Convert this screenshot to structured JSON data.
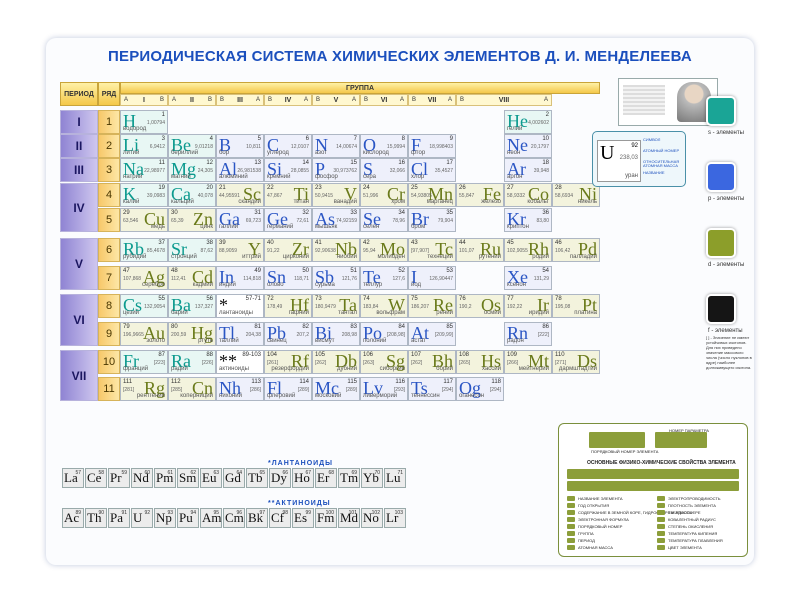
{
  "title": "ПЕРИОДИЧЕСКАЯ СИСТЕМА ХИМИЧЕСКИХ ЭЛЕМЕНТОВ Д. И. МЕНДЕЛЕЕВА",
  "headers": {
    "period": "ПЕРИОД",
    "row": "РЯД",
    "group": "ГРУППА"
  },
  "groups": [
    {
      "roman": "I",
      "a": "A",
      "b": "B"
    },
    {
      "roman": "II",
      "a": "A",
      "b": "B"
    },
    {
      "roman": "III",
      "a": "B",
      "b": "A"
    },
    {
      "roman": "IV",
      "a": "B",
      "b": "A"
    },
    {
      "roman": "V",
      "a": "B",
      "b": "A"
    },
    {
      "roman": "VI",
      "a": "B",
      "b": "A"
    },
    {
      "roman": "VII",
      "a": "B",
      "b": "A"
    },
    {
      "roman": "VIII",
      "a": "B",
      "b": "A"
    }
  ],
  "periods": [
    {
      "label": "I",
      "rows": 1
    },
    {
      "label": "II",
      "rows": 1
    },
    {
      "label": "III",
      "rows": 1
    },
    {
      "label": "IV",
      "rows": 2
    },
    {
      "label": "V",
      "rows": 2
    },
    {
      "label": "VI",
      "rows": 2
    },
    {
      "label": "VII",
      "rows": 2
    }
  ],
  "rows": [
    "1",
    "2",
    "3",
    "4",
    "5",
    "6",
    "7",
    "8",
    "9",
    "10",
    "11"
  ],
  "elements": [
    {
      "r": 0,
      "c": 0,
      "sym": "H",
      "z": "1",
      "mass": "1,00794",
      "name": "водород",
      "t": "s",
      "al": "l"
    },
    {
      "r": 0,
      "c": 8,
      "sym": "He",
      "z": "2",
      "mass": "4,002602",
      "name": "гелий",
      "t": "s",
      "al": "l"
    },
    {
      "r": 1,
      "c": 0,
      "sym": "Li",
      "z": "3",
      "mass": "6,9412",
      "name": "литий",
      "t": "s",
      "al": "l"
    },
    {
      "r": 1,
      "c": 1,
      "sym": "Be",
      "z": "4",
      "mass": "9,01218",
      "name": "бериллий",
      "t": "s",
      "al": "l"
    },
    {
      "r": 1,
      "c": 2,
      "sym": "B",
      "z": "5",
      "mass": "10,811",
      "name": "бор",
      "t": "p",
      "al": "l"
    },
    {
      "r": 1,
      "c": 3,
      "sym": "C",
      "z": "6",
      "mass": "12,0107",
      "name": "углерод",
      "t": "p",
      "al": "l"
    },
    {
      "r": 1,
      "c": 4,
      "sym": "N",
      "z": "7",
      "mass": "14,00674",
      "name": "азот",
      "t": "p",
      "al": "l"
    },
    {
      "r": 1,
      "c": 5,
      "sym": "O",
      "z": "8",
      "mass": "15,9994",
      "name": "кислород",
      "t": "p",
      "al": "l"
    },
    {
      "r": 1,
      "c": 6,
      "sym": "F",
      "z": "9",
      "mass": "18,998403",
      "name": "фтор",
      "t": "p",
      "al": "l"
    },
    {
      "r": 1,
      "c": 8,
      "sym": "Ne",
      "z": "10",
      "mass": "20,1797",
      "name": "неон",
      "t": "p",
      "al": "l"
    },
    {
      "r": 2,
      "c": 0,
      "sym": "Na",
      "z": "11",
      "mass": "22,98977",
      "name": "натрий",
      "t": "s",
      "al": "l"
    },
    {
      "r": 2,
      "c": 1,
      "sym": "Mg",
      "z": "12",
      "mass": "24,305",
      "name": "магний",
      "t": "s",
      "al": "l"
    },
    {
      "r": 2,
      "c": 2,
      "sym": "Al",
      "z": "13",
      "mass": "26,981538",
      "name": "алюминий",
      "t": "p",
      "al": "l"
    },
    {
      "r": 2,
      "c": 3,
      "sym": "Si",
      "z": "14",
      "mass": "28,0855",
      "name": "кремний",
      "t": "p",
      "al": "l"
    },
    {
      "r": 2,
      "c": 4,
      "sym": "P",
      "z": "15",
      "mass": "30,973762",
      "name": "фосфор",
      "t": "p",
      "al": "l"
    },
    {
      "r": 2,
      "c": 5,
      "sym": "S",
      "z": "16",
      "mass": "32,066",
      "name": "сера",
      "t": "p",
      "al": "l"
    },
    {
      "r": 2,
      "c": 6,
      "sym": "Cl",
      "z": "17",
      "mass": "35,4527",
      "name": "хлор",
      "t": "p",
      "al": "l"
    },
    {
      "r": 2,
      "c": 8,
      "sym": "Ar",
      "z": "18",
      "mass": "39,948",
      "name": "аргон",
      "t": "p",
      "al": "l"
    },
    {
      "r": 3,
      "c": 0,
      "sym": "K",
      "z": "19",
      "mass": "39,0983",
      "name": "калий",
      "t": "s",
      "al": "l"
    },
    {
      "r": 3,
      "c": 1,
      "sym": "Ca",
      "z": "20",
      "mass": "40,078",
      "name": "кальций",
      "t": "s",
      "al": "l"
    },
    {
      "r": 3,
      "c": 2,
      "sym": "Sc",
      "z": "21",
      "mass": "44,95591",
      "name": "скандий",
      "t": "d",
      "al": "r"
    },
    {
      "r": 3,
      "c": 3,
      "sym": "Ti",
      "z": "22",
      "mass": "47,867",
      "name": "титан",
      "t": "d",
      "al": "r"
    },
    {
      "r": 3,
      "c": 4,
      "sym": "V",
      "z": "23",
      "mass": "50,9415",
      "name": "ванадий",
      "t": "d",
      "al": "r"
    },
    {
      "r": 3,
      "c": 5,
      "sym": "Cr",
      "z": "24",
      "mass": "51,996",
      "name": "хром",
      "t": "d",
      "al": "r"
    },
    {
      "r": 3,
      "c": 6,
      "sym": "Mn",
      "z": "25",
      "mass": "54,93805",
      "name": "марганец",
      "t": "d",
      "al": "r"
    },
    {
      "r": 3,
      "c": 7,
      "sym": "Fe",
      "z": "26",
      "mass": "55,847",
      "name": "железо",
      "t": "d",
      "al": "r"
    },
    {
      "r": 3,
      "c": 8,
      "sym": "Co",
      "z": "27",
      "mass": "58,9332",
      "name": "кобальт",
      "t": "d",
      "al": "r"
    },
    {
      "r": 3,
      "c": 9,
      "sym": "Ni",
      "z": "28",
      "mass": "58,6934",
      "name": "никель",
      "t": "d",
      "al": "r"
    },
    {
      "r": 4,
      "c": 0,
      "sym": "Cu",
      "z": "29",
      "mass": "63,546",
      "name": "медь",
      "t": "d",
      "al": "r"
    },
    {
      "r": 4,
      "c": 1,
      "sym": "Zn",
      "z": "30",
      "mass": "65,39",
      "name": "цинк",
      "t": "d",
      "al": "r"
    },
    {
      "r": 4,
      "c": 2,
      "sym": "Ga",
      "z": "31",
      "mass": "69,723",
      "name": "галлий",
      "t": "p",
      "al": "l"
    },
    {
      "r": 4,
      "c": 3,
      "sym": "Ge",
      "z": "32",
      "mass": "72,61",
      "name": "германий",
      "t": "p",
      "al": "l"
    },
    {
      "r": 4,
      "c": 4,
      "sym": "As",
      "z": "33",
      "mass": "74,92159",
      "name": "мышьяк",
      "t": "p",
      "al": "l"
    },
    {
      "r": 4,
      "c": 5,
      "sym": "Se",
      "z": "34",
      "mass": "78,96",
      "name": "селен",
      "t": "p",
      "al": "l"
    },
    {
      "r": 4,
      "c": 6,
      "sym": "Br",
      "z": "35",
      "mass": "79,904",
      "name": "бром",
      "t": "p",
      "al": "l"
    },
    {
      "r": 4,
      "c": 8,
      "sym": "Kr",
      "z": "36",
      "mass": "83,80",
      "name": "криптон",
      "t": "p",
      "al": "l"
    },
    {
      "r": 5,
      "c": 0,
      "sym": "Rb",
      "z": "37",
      "mass": "85,4678",
      "name": "рубидий",
      "t": "s",
      "al": "l"
    },
    {
      "r": 5,
      "c": 1,
      "sym": "Sr",
      "z": "38",
      "mass": "87,62",
      "name": "стронций",
      "t": "s",
      "al": "l"
    },
    {
      "r": 5,
      "c": 2,
      "sym": "Y",
      "z": "39",
      "mass": "88,9059",
      "name": "иттрий",
      "t": "d",
      "al": "r"
    },
    {
      "r": 5,
      "c": 3,
      "sym": "Zr",
      "z": "40",
      "mass": "91,22",
      "name": "цирконий",
      "t": "d",
      "al": "r"
    },
    {
      "r": 5,
      "c": 4,
      "sym": "Nb",
      "z": "41",
      "mass": "92,90638",
      "name": "ниобий",
      "t": "d",
      "al": "r"
    },
    {
      "r": 5,
      "c": 5,
      "sym": "Mo",
      "z": "42",
      "mass": "95,94",
      "name": "молибден",
      "t": "d",
      "al": "r"
    },
    {
      "r": 5,
      "c": 6,
      "sym": "Tc",
      "z": "43",
      "mass": "[97,907]",
      "name": "технеций",
      "t": "d",
      "al": "r"
    },
    {
      "r": 5,
      "c": 7,
      "sym": "Ru",
      "z": "44",
      "mass": "101,07",
      "name": "рутений",
      "t": "d",
      "al": "r"
    },
    {
      "r": 5,
      "c": 8,
      "sym": "Rh",
      "z": "45",
      "mass": "102,9055",
      "name": "родий",
      "t": "d",
      "al": "r"
    },
    {
      "r": 5,
      "c": 9,
      "sym": "Pd",
      "z": "46",
      "mass": "106,42",
      "name": "палладий",
      "t": "d",
      "al": "r"
    },
    {
      "r": 6,
      "c": 0,
      "sym": "Ag",
      "z": "47",
      "mass": "107,868",
      "name": "серебро",
      "t": "d",
      "al": "r"
    },
    {
      "r": 6,
      "c": 1,
      "sym": "Cd",
      "z": "48",
      "mass": "112,41",
      "name": "кадмий",
      "t": "d",
      "al": "r"
    },
    {
      "r": 6,
      "c": 2,
      "sym": "In",
      "z": "49",
      "mass": "114,818",
      "name": "индий",
      "t": "p",
      "al": "l"
    },
    {
      "r": 6,
      "c": 3,
      "sym": "Sn",
      "z": "50",
      "mass": "118,71",
      "name": "олово",
      "t": "p",
      "al": "l"
    },
    {
      "r": 6,
      "c": 4,
      "sym": "Sb",
      "z": "51",
      "mass": "121,76",
      "name": "сурьма",
      "t": "p",
      "al": "l"
    },
    {
      "r": 6,
      "c": 5,
      "sym": "Te",
      "z": "52",
      "mass": "127,6",
      "name": "теллур",
      "t": "p",
      "al": "l"
    },
    {
      "r": 6,
      "c": 6,
      "sym": "I",
      "z": "53",
      "mass": "126,90447",
      "name": "йод",
      "t": "p",
      "al": "l"
    },
    {
      "r": 6,
      "c": 8,
      "sym": "Xe",
      "z": "54",
      "mass": "131,29",
      "name": "ксенон",
      "t": "p",
      "al": "l"
    },
    {
      "r": 7,
      "c": 0,
      "sym": "Cs",
      "z": "55",
      "mass": "132,9054",
      "name": "цезий",
      "t": "s",
      "al": "l"
    },
    {
      "r": 7,
      "c": 1,
      "sym": "Ba",
      "z": "56",
      "mass": "137,327",
      "name": "барий",
      "t": "s",
      "al": "l"
    },
    {
      "r": 7,
      "c": 2,
      "sym": "*",
      "z": "57-71",
      "mass": "",
      "name": "лантаноиды",
      "t": "n",
      "al": "l"
    },
    {
      "r": 7,
      "c": 3,
      "sym": "Hf",
      "z": "72",
      "mass": "178,49",
      "name": "гафний",
      "t": "d",
      "al": "r"
    },
    {
      "r": 7,
      "c": 4,
      "sym": "Ta",
      "z": "73",
      "mass": "180,9479",
      "name": "тантал",
      "t": "d",
      "al": "r"
    },
    {
      "r": 7,
      "c": 5,
      "sym": "W",
      "z": "74",
      "mass": "183,84",
      "name": "вольфрам",
      "t": "d",
      "al": "r"
    },
    {
      "r": 7,
      "c": 6,
      "sym": "Re",
      "z": "75",
      "mass": "186,207",
      "name": "рений",
      "t": "d",
      "al": "r"
    },
    {
      "r": 7,
      "c": 7,
      "sym": "Os",
      "z": "76",
      "mass": "190,2",
      "name": "осмий",
      "t": "d",
      "al": "r"
    },
    {
      "r": 7,
      "c": 8,
      "sym": "Ir",
      "z": "77",
      "mass": "192,22",
      "name": "иридий",
      "t": "d",
      "al": "r"
    },
    {
      "r": 7,
      "c": 9,
      "sym": "Pt",
      "z": "78",
      "mass": "195,08",
      "name": "платина",
      "t": "d",
      "al": "r"
    },
    {
      "r": 8,
      "c": 0,
      "sym": "Au",
      "z": "79",
      "mass": "196,9665",
      "name": "золото",
      "t": "d",
      "al": "r"
    },
    {
      "r": 8,
      "c": 1,
      "sym": "Hg",
      "z": "80",
      "mass": "200,59",
      "name": "ртуть",
      "t": "d",
      "al": "r"
    },
    {
      "r": 8,
      "c": 2,
      "sym": "Tl",
      "z": "81",
      "mass": "204,38",
      "name": "таллий",
      "t": "p",
      "al": "l"
    },
    {
      "r": 8,
      "c": 3,
      "sym": "Pb",
      "z": "82",
      "mass": "207,2",
      "name": "свинец",
      "t": "p",
      "al": "l"
    },
    {
      "r": 8,
      "c": 4,
      "sym": "Bi",
      "z": "83",
      "mass": "208,98",
      "name": "висмут",
      "t": "p",
      "al": "l"
    },
    {
      "r": 8,
      "c": 5,
      "sym": "Po",
      "z": "84",
      "mass": "[208,98]",
      "name": "полоний",
      "t": "p",
      "al": "l"
    },
    {
      "r": 8,
      "c": 6,
      "sym": "At",
      "z": "85",
      "mass": "[209,99]",
      "name": "астат",
      "t": "p",
      "al": "l"
    },
    {
      "r": 8,
      "c": 8,
      "sym": "Rn",
      "z": "86",
      "mass": "[222]",
      "name": "радон",
      "t": "p",
      "al": "l"
    },
    {
      "r": 9,
      "c": 0,
      "sym": "Fr",
      "z": "87",
      "mass": "[223]",
      "name": "франций",
      "t": "s",
      "al": "l"
    },
    {
      "r": 9,
      "c": 1,
      "sym": "Ra",
      "z": "88",
      "mass": "[226]",
      "name": "радий",
      "t": "s",
      "al": "l"
    },
    {
      "r": 9,
      "c": 2,
      "sym": "**",
      "z": "89-103",
      "mass": "",
      "name": "актиноиды",
      "t": "n",
      "al": "l"
    },
    {
      "r": 9,
      "c": 3,
      "sym": "Rf",
      "z": "104",
      "mass": "[261]",
      "name": "резерфордий",
      "t": "d",
      "al": "r"
    },
    {
      "r": 9,
      "c": 4,
      "sym": "Db",
      "z": "105",
      "mass": "[262]",
      "name": "дубний",
      "t": "d",
      "al": "r"
    },
    {
      "r": 9,
      "c": 5,
      "sym": "Sg",
      "z": "106",
      "mass": "[263]",
      "name": "сиборгий",
      "t": "d",
      "al": "r"
    },
    {
      "r": 9,
      "c": 6,
      "sym": "Bh",
      "z": "107",
      "mass": "[262]",
      "name": "борий",
      "t": "d",
      "al": "r"
    },
    {
      "r": 9,
      "c": 7,
      "sym": "Hs",
      "z": "108",
      "mass": "[265]",
      "name": "хассий",
      "t": "d",
      "al": "r"
    },
    {
      "r": 9,
      "c": 8,
      "sym": "Mt",
      "z": "109",
      "mass": "[266]",
      "name": "мейтнерий",
      "t": "d",
      "al": "r"
    },
    {
      "r": 9,
      "c": 9,
      "sym": "Ds",
      "z": "110",
      "mass": "[271]",
      "name": "дармштадтий",
      "t": "d",
      "al": "r"
    },
    {
      "r": 10,
      "c": 0,
      "sym": "Rg",
      "z": "111",
      "mass": "[281]",
      "name": "рентгений",
      "t": "d",
      "al": "r"
    },
    {
      "r": 10,
      "c": 1,
      "sym": "Cn",
      "z": "112",
      "mass": "[285]",
      "name": "коперниций",
      "t": "d",
      "al": "r"
    },
    {
      "r": 10,
      "c": 2,
      "sym": "Nh",
      "z": "113",
      "mass": "[286]",
      "name": "нихоний",
      "t": "p",
      "al": "l"
    },
    {
      "r": 10,
      "c": 3,
      "sym": "Fl",
      "z": "114",
      "mass": "[289]",
      "name": "флеровий",
      "t": "p",
      "al": "l"
    },
    {
      "r": 10,
      "c": 4,
      "sym": "Mc",
      "z": "115",
      "mass": "[289]",
      "name": "московий",
      "t": "p",
      "al": "l"
    },
    {
      "r": 10,
      "c": 5,
      "sym": "Lv",
      "z": "116",
      "mass": "[293]",
      "name": "ливерморий",
      "t": "p",
      "al": "l"
    },
    {
      "r": 10,
      "c": 6,
      "sym": "Ts",
      "z": "117",
      "mass": "[294]",
      "name": "теннессин",
      "t": "p",
      "al": "l"
    },
    {
      "r": 10,
      "c": 7,
      "sym": "Og",
      "z": "118",
      "mass": "[294]",
      "name": "оганесон",
      "t": "p",
      "al": "l"
    }
  ],
  "lanthanoids_label": "*ЛАНТАНОИДЫ",
  "actinoids_label": "**АКТИНОИДЫ",
  "lanthanoids": [
    {
      "sym": "La",
      "z": "57"
    },
    {
      "sym": "Ce",
      "z": "58"
    },
    {
      "sym": "Pr",
      "z": "59"
    },
    {
      "sym": "Nd",
      "z": "60"
    },
    {
      "sym": "Pm",
      "z": "61"
    },
    {
      "sym": "Sm",
      "z": "62"
    },
    {
      "sym": "Eu",
      "z": "63"
    },
    {
      "sym": "Gd",
      "z": "64"
    },
    {
      "sym": "Tb",
      "z": "65"
    },
    {
      "sym": "Dy",
      "z": "66"
    },
    {
      "sym": "Ho",
      "z": "67"
    },
    {
      "sym": "Er",
      "z": "68"
    },
    {
      "sym": "Tm",
      "z": "69"
    },
    {
      "sym": "Yb",
      "z": "70"
    },
    {
      "sym": "Lu",
      "z": "71"
    }
  ],
  "actinoids": [
    {
      "sym": "Ac",
      "z": "89"
    },
    {
      "sym": "Th",
      "z": "90"
    },
    {
      "sym": "Pa",
      "z": "91"
    },
    {
      "sym": "U",
      "z": "92"
    },
    {
      "sym": "Np",
      "z": "93"
    },
    {
      "sym": "Pu",
      "z": "94"
    },
    {
      "sym": "Am",
      "z": "95"
    },
    {
      "sym": "Cm",
      "z": "96"
    },
    {
      "sym": "Bk",
      "z": "97"
    },
    {
      "sym": "Cf",
      "z": "98"
    },
    {
      "sym": "Es",
      "z": "99"
    },
    {
      "sym": "Fm",
      "z": "100"
    },
    {
      "sym": "Md",
      "z": "101"
    },
    {
      "sym": "No",
      "z": "102"
    },
    {
      "sym": "Lr",
      "z": "103"
    }
  ],
  "sample": {
    "sym": "U",
    "z": "92",
    "mass": "238,03",
    "name": "уран",
    "labels": [
      "СИМВОЛ",
      "АТОМНЫЙ НОМЕР",
      "ОТНОСИТЕЛЬНАЯ АТОМНАЯ МАССА",
      "НАЗВАНИЕ"
    ]
  },
  "key": [
    {
      "label": "s - элементы",
      "color": "#1aa596"
    },
    {
      "label": "p - элементы",
      "color": "#3b67e0"
    },
    {
      "label": "d - элементы",
      "color": "#8c9e2a"
    },
    {
      "label": "f - элементы",
      "color": "#151515"
    }
  ],
  "key_note": "[ ] - Значение не имеют устойчивых изотопов. Для них приведено значение массового числа (число нуклонов в ядре) наиболее долгоживущего изотопа.",
  "legend": {
    "order_label": "ПОРЯДКОВЫЙ НОМЕР ЭЛЕМЕНТА",
    "param_label": "НОМЕР ПАРАМЕТРА",
    "title": "ОСНОВНЫЕ ФИЗИКО-ХИМИЧЕСКИЕ СВОЙСТВА ЭЛЕМЕНТА",
    "left_items": [
      "НАЗВАНИЕ ЭЛЕМЕНТА",
      "ГОД ОТКРЫТИЯ",
      "СОДЕРЖАНИЕ В ЗЕМНОЙ КОРЕ, ГИДРОСФЕРЕ И АТМОСФЕРЕ",
      "ЭЛЕКТРОННАЯ ФОРМУЛА",
      "ПОРЯДКОВЫЙ НОМЕР",
      "ГРУППА",
      "ПЕРИОД",
      "АТОМНАЯ МАССА"
    ],
    "right_items": [
      "ЭЛЕКТРОПРОВОДИМОСТЬ",
      "ПЛОТНОСТЬ ЭЛЕМЕНТА",
      "ТВЕРДОСТЬ",
      "КОВАЛЕНТНЫЙ РАДИУС",
      "СТЕПЕНЬ ОКИСЛЕНИЯ",
      "ТЕМПЕРАТУРА КИПЕНИЯ",
      "ТЕМПЕРАТУРА ПЛАВЛЕНИЯ",
      "ЦВЕТ ЭЛЕМЕНТА"
    ]
  }
}
